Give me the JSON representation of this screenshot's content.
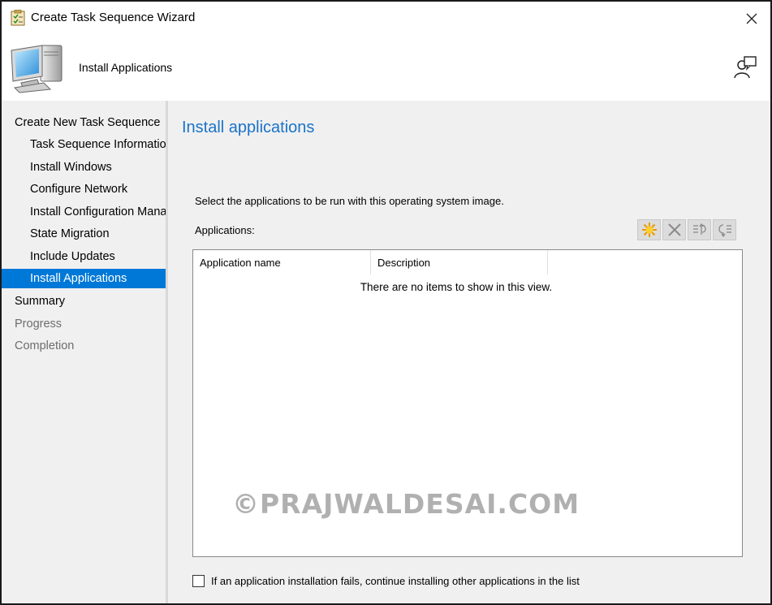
{
  "window": {
    "title": "Create Task Sequence Wizard"
  },
  "banner": {
    "page_name": "Install Applications"
  },
  "nav": {
    "items": [
      {
        "label": "Create New Task Sequence",
        "level": "top",
        "state": "normal"
      },
      {
        "label": "Task Sequence Information",
        "level": "sub",
        "state": "normal"
      },
      {
        "label": "Install Windows",
        "level": "sub",
        "state": "normal"
      },
      {
        "label": "Configure Network",
        "level": "sub",
        "state": "normal"
      },
      {
        "label": "Install Configuration Manager",
        "level": "sub",
        "state": "normal"
      },
      {
        "label": "State Migration",
        "level": "sub",
        "state": "normal"
      },
      {
        "label": "Include Updates",
        "level": "sub",
        "state": "normal"
      },
      {
        "label": "Install Applications",
        "level": "sub",
        "state": "active"
      },
      {
        "label": "Summary",
        "level": "top",
        "state": "normal"
      },
      {
        "label": "Progress",
        "level": "top",
        "state": "disabled"
      },
      {
        "label": "Completion",
        "level": "top",
        "state": "disabled"
      }
    ]
  },
  "main": {
    "title": "Install applications",
    "instructions": "Select the applications to be run with this operating system image.",
    "applications_label": "Applications:",
    "toolbar": [
      {
        "icon": "new-star-icon"
      },
      {
        "icon": "delete-x-icon"
      },
      {
        "icon": "move-up-icon"
      },
      {
        "icon": "move-down-icon"
      }
    ],
    "list": {
      "columns": [
        "Application name",
        "Description"
      ],
      "empty_message": "There are no items to show in this view."
    },
    "watermark": "©PRAJWALDESAI.COM",
    "continue_checkbox": {
      "label": "If an application installation fails, continue installing other applications in the list",
      "checked": false
    }
  },
  "colors": {
    "accent": "#0078d7",
    "title_blue": "#1a73c8",
    "panel_bg": "#f0f0f0"
  }
}
